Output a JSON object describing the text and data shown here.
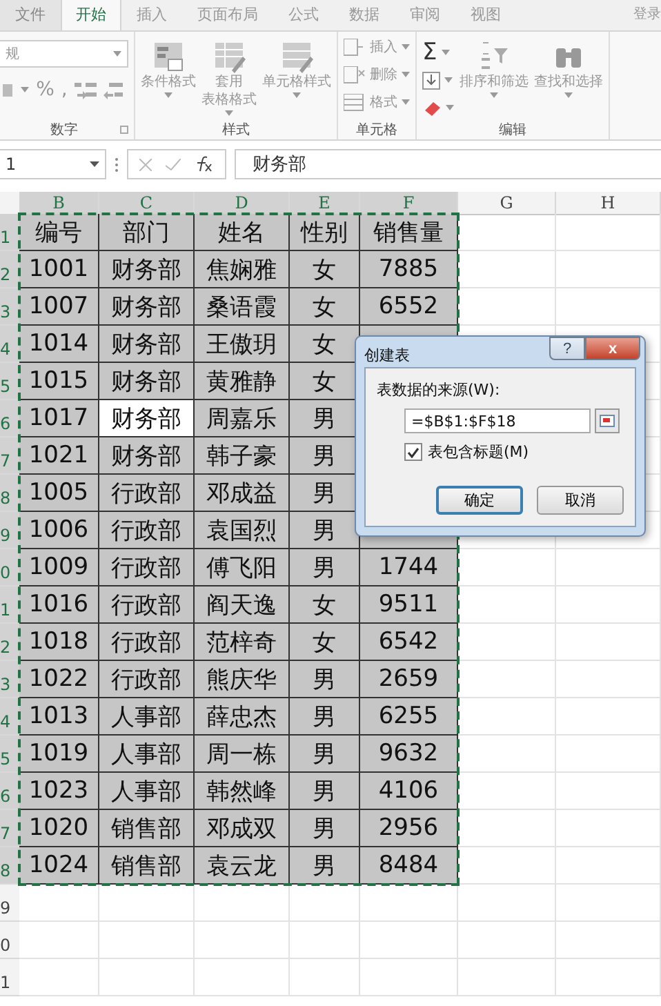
{
  "ribbon": {
    "disabled": true,
    "tabs": [
      {
        "label": "文件",
        "selected": false
      },
      {
        "label": "开始",
        "selected": true
      },
      {
        "label": "插入",
        "selected": false
      },
      {
        "label": "页面布局",
        "selected": false
      },
      {
        "label": "公式",
        "selected": false
      },
      {
        "label": "数据",
        "selected": false
      },
      {
        "label": "审阅",
        "selected": false
      },
      {
        "label": "视图",
        "selected": false
      }
    ],
    "account": "登录",
    "groups": [
      {
        "kind": "number",
        "label": "数字",
        "format": "规",
        "symbols": [
          "%",
          ","
        ]
      },
      {
        "kind": "styles",
        "label": "样式",
        "buttons": [
          {
            "lines": [
              "条件格式"
            ]
          },
          {
            "lines": [
              "套用",
              "表格格式"
            ]
          },
          {
            "lines": [
              "单元格样式"
            ]
          }
        ]
      },
      {
        "kind": "cells",
        "label": "单元格",
        "buttons": [
          "插入",
          "删除",
          "格式"
        ]
      },
      {
        "kind": "editing",
        "label": "编辑",
        "sum": "Σ",
        "buttons": [
          "排序和筛选",
          "查找和选择"
        ]
      }
    ]
  },
  "formula_bar": {
    "name_box": "1",
    "content": "财务部"
  },
  "grid": {
    "columns": [
      {
        "label": "B",
        "selected": true
      },
      {
        "label": "C",
        "selected": true
      },
      {
        "label": "D",
        "selected": true
      },
      {
        "label": "E",
        "selected": true
      },
      {
        "label": "F",
        "selected": true
      },
      {
        "label": "G",
        "selected": false
      },
      {
        "label": "H",
        "selected": false
      }
    ],
    "rows": [
      {
        "header": "1",
        "selected": true,
        "cells": [
          {
            "text": "编号",
            "active": false
          },
          {
            "text": "部门",
            "active": false
          },
          {
            "text": "姓名",
            "active": false
          },
          {
            "text": "性别",
            "active": false
          },
          {
            "text": "销售量",
            "active": false
          }
        ]
      },
      {
        "header": "2",
        "selected": true,
        "cells": [
          {
            "text": "1001",
            "active": false
          },
          {
            "text": "财务部",
            "active": false
          },
          {
            "text": "焦娴雅",
            "active": false
          },
          {
            "text": "女",
            "active": false
          },
          {
            "text": "7885",
            "active": false
          }
        ]
      },
      {
        "header": "3",
        "selected": true,
        "cells": [
          {
            "text": "1007",
            "active": false
          },
          {
            "text": "财务部",
            "active": false
          },
          {
            "text": "桑语霞",
            "active": false
          },
          {
            "text": "女",
            "active": false
          },
          {
            "text": "6552",
            "active": false
          }
        ]
      },
      {
        "header": "4",
        "selected": true,
        "cells": [
          {
            "text": "1014",
            "active": false
          },
          {
            "text": "财务部",
            "active": false
          },
          {
            "text": "王傲玥",
            "active": false
          },
          {
            "text": "女",
            "active": false
          }
        ]
      },
      {
        "header": "5",
        "selected": true,
        "cells": [
          {
            "text": "1015",
            "active": false
          },
          {
            "text": "财务部",
            "active": false
          },
          {
            "text": "黄雅静",
            "active": false
          },
          {
            "text": "女",
            "active": false
          }
        ]
      },
      {
        "header": "6",
        "selected": true,
        "cells": [
          {
            "text": "1017",
            "active": false
          },
          {
            "text": "财务部",
            "active": true
          },
          {
            "text": "周嘉乐",
            "active": false
          },
          {
            "text": "男",
            "active": false
          }
        ]
      },
      {
        "header": "7",
        "selected": true,
        "cells": [
          {
            "text": "1021",
            "active": false
          },
          {
            "text": "财务部",
            "active": false
          },
          {
            "text": "韩子豪",
            "active": false
          },
          {
            "text": "男",
            "active": false
          }
        ]
      },
      {
        "header": "8",
        "selected": true,
        "cells": [
          {
            "text": "1005",
            "active": false
          },
          {
            "text": "行政部",
            "active": false
          },
          {
            "text": "邓成益",
            "active": false
          },
          {
            "text": "男",
            "active": false
          }
        ]
      },
      {
        "header": "9",
        "selected": true,
        "cells": [
          {
            "text": "1006",
            "active": false
          },
          {
            "text": "行政部",
            "active": false
          },
          {
            "text": "袁国烈",
            "active": false
          },
          {
            "text": "男",
            "active": false
          }
        ]
      },
      {
        "header": "0",
        "selected": true,
        "cells": [
          {
            "text": "1009",
            "active": false
          },
          {
            "text": "行政部",
            "active": false
          },
          {
            "text": "傅飞阳",
            "active": false
          },
          {
            "text": "男",
            "active": false
          },
          {
            "text": "1744",
            "active": false
          }
        ]
      },
      {
        "header": "1",
        "selected": true,
        "cells": [
          {
            "text": "1016",
            "active": false
          },
          {
            "text": "行政部",
            "active": false
          },
          {
            "text": "阎天逸",
            "active": false
          },
          {
            "text": "女",
            "active": false
          },
          {
            "text": "9511",
            "active": false
          }
        ]
      },
      {
        "header": "2",
        "selected": true,
        "cells": [
          {
            "text": "1018",
            "active": false
          },
          {
            "text": "行政部",
            "active": false
          },
          {
            "text": "范梓奇",
            "active": false
          },
          {
            "text": "女",
            "active": false
          },
          {
            "text": "6542",
            "active": false
          }
        ]
      },
      {
        "header": "3",
        "selected": true,
        "cells": [
          {
            "text": "1022",
            "active": false
          },
          {
            "text": "行政部",
            "active": false
          },
          {
            "text": "熊庆华",
            "active": false
          },
          {
            "text": "男",
            "active": false
          },
          {
            "text": "2659",
            "active": false
          }
        ]
      },
      {
        "header": "4",
        "selected": true,
        "cells": [
          {
            "text": "1013",
            "active": false
          },
          {
            "text": "人事部",
            "active": false
          },
          {
            "text": "薛忠杰",
            "active": false
          },
          {
            "text": "男",
            "active": false
          },
          {
            "text": "6255",
            "active": false
          }
        ]
      },
      {
        "header": "5",
        "selected": true,
        "cells": [
          {
            "text": "1019",
            "active": false
          },
          {
            "text": "人事部",
            "active": false
          },
          {
            "text": "周一栋",
            "active": false
          },
          {
            "text": "男",
            "active": false
          },
          {
            "text": "9632",
            "active": false
          }
        ]
      },
      {
        "header": "6",
        "selected": true,
        "cells": [
          {
            "text": "1023",
            "active": false
          },
          {
            "text": "人事部",
            "active": false
          },
          {
            "text": "韩然峰",
            "active": false
          },
          {
            "text": "男",
            "active": false
          },
          {
            "text": "4106",
            "active": false
          }
        ]
      },
      {
        "header": "7",
        "selected": true,
        "cells": [
          {
            "text": "1020",
            "active": false
          },
          {
            "text": "销售部",
            "active": false
          },
          {
            "text": "邓成双",
            "active": false
          },
          {
            "text": "男",
            "active": false
          },
          {
            "text": "2956",
            "active": false
          }
        ]
      },
      {
        "header": "8",
        "selected": true,
        "cells": [
          {
            "text": "1024",
            "active": false
          },
          {
            "text": "销售部",
            "active": false
          },
          {
            "text": "袁云龙",
            "active": false
          },
          {
            "text": "男",
            "active": false
          },
          {
            "text": "8484",
            "active": false
          }
        ]
      },
      {
        "header": "9",
        "selected": false,
        "cells": []
      },
      {
        "header": "0",
        "selected": false,
        "cells": []
      },
      {
        "header": "1",
        "selected": false,
        "cells": []
      }
    ]
  },
  "dialog": {
    "title": "创建表",
    "help_button": "?",
    "close_button": "x",
    "source_label": "表数据的来源(W):",
    "source_value": "=$B$1:$F$18",
    "checkbox": {
      "label": "表包含标题(M)",
      "checked": true
    },
    "buttons": [
      {
        "label": "确定",
        "default": true
      },
      {
        "label": "取消",
        "default": false
      }
    ]
  }
}
